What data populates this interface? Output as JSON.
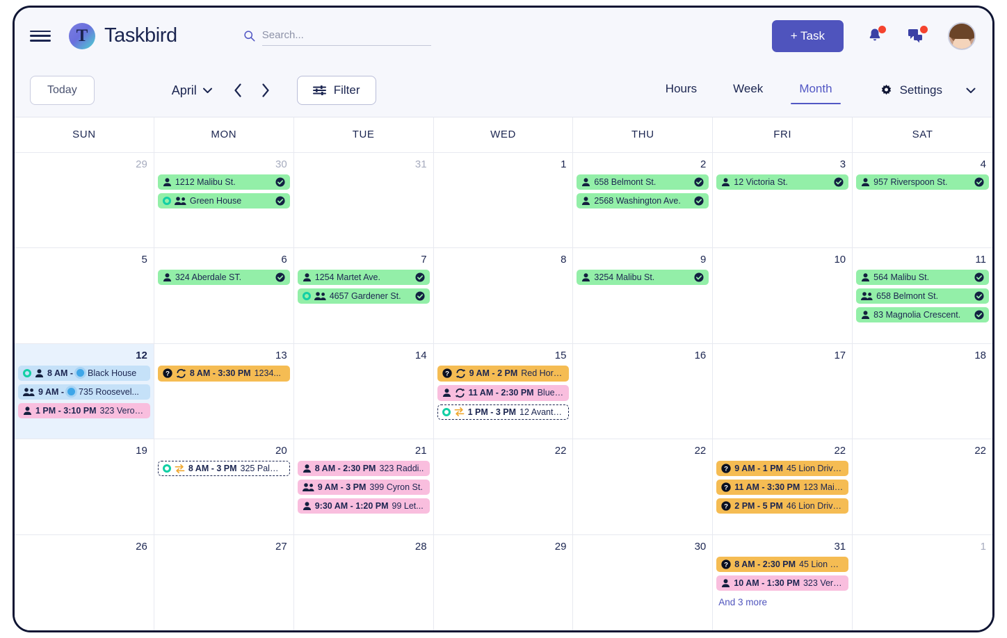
{
  "header": {
    "brand": "Taskbird",
    "menu_icon": "hamburger-icon",
    "search": {
      "placeholder": "Search...",
      "value": "",
      "icon": "search-icon"
    },
    "add_task_label": "+ Task",
    "notifications_icon": "bell-icon",
    "messages_icon": "chat-icon",
    "avatar_label": "user-avatar",
    "accent_color": "#4f54bd",
    "badge_color": "#f5432e"
  },
  "toolbar": {
    "today_label": "Today",
    "month_label": "April",
    "month_caret": "chevron-down-icon",
    "prev_label": "‹",
    "next_label": "›",
    "filter_label": "Filter",
    "filter_icon": "sliders-icon",
    "views": [
      {
        "label": "Hours",
        "active": false
      },
      {
        "label": "Week",
        "active": false
      },
      {
        "label": "Month",
        "active": true
      }
    ],
    "settings_label": "Settings",
    "settings_icon": "gear-icon",
    "settings_caret": "chevron-down-icon"
  },
  "calendar": {
    "weekdays": [
      "SUN",
      "MON",
      "TUE",
      "WED",
      "THU",
      "FRI",
      "SAT"
    ],
    "more_label": "And 3 more",
    "weeks": [
      {
        "days": [
          {
            "num": "29",
            "other": true,
            "today": false,
            "events": []
          },
          {
            "num": "30",
            "other": true,
            "today": false,
            "events": [
              {
                "color": "green",
                "person": "single",
                "text": "1212 Malibu St.",
                "done": true
              },
              {
                "color": "green",
                "ring": true,
                "person": "group",
                "text": "Green House",
                "done": true
              }
            ]
          },
          {
            "num": "31",
            "other": true,
            "today": false,
            "events": []
          },
          {
            "num": "1",
            "other": false,
            "today": false,
            "events": []
          },
          {
            "num": "2",
            "other": false,
            "today": false,
            "events": [
              {
                "color": "green",
                "person": "single",
                "text": "658 Belmont St.",
                "done": true
              },
              {
                "color": "green",
                "person": "single",
                "text": "2568 Washington Ave.",
                "done": true
              }
            ]
          },
          {
            "num": "3",
            "other": false,
            "today": false,
            "events": [
              {
                "color": "green",
                "person": "single",
                "text": "12 Victoria St.",
                "done": true
              }
            ]
          },
          {
            "num": "4",
            "other": false,
            "today": false,
            "events": [
              {
                "color": "green",
                "person": "single",
                "text": "957 Riverspoon St.",
                "done": true
              }
            ]
          }
        ]
      },
      {
        "days": [
          {
            "num": "5",
            "other": false,
            "today": false,
            "events": []
          },
          {
            "num": "6",
            "other": false,
            "today": false,
            "events": [
              {
                "color": "green",
                "person": "single",
                "text": "324 Aberdale ST.",
                "done": true
              }
            ]
          },
          {
            "num": "7",
            "other": false,
            "today": false,
            "events": [
              {
                "color": "green",
                "person": "single",
                "text": "1254 Martet Ave.",
                "done": true
              },
              {
                "color": "green",
                "ring": true,
                "person": "group",
                "text": "4657 Gardener St.",
                "done": true
              }
            ]
          },
          {
            "num": "8",
            "other": false,
            "today": false,
            "events": []
          },
          {
            "num": "9",
            "other": false,
            "today": false,
            "events": [
              {
                "color": "green",
                "person": "single",
                "text": "3254 Malibu St.",
                "done": true
              }
            ]
          },
          {
            "num": "10",
            "other": false,
            "today": false,
            "events": []
          },
          {
            "num": "11",
            "other": false,
            "today": false,
            "events": [
              {
                "color": "green",
                "person": "single",
                "text": "564 Malibu St.",
                "done": true
              },
              {
                "color": "green",
                "person": "group",
                "text": "658 Belmont St.",
                "done": true
              },
              {
                "color": "green",
                "person": "single",
                "text": "83 Magnolia Crescent.",
                "done": true
              }
            ]
          }
        ]
      },
      {
        "days": [
          {
            "num": "12",
            "other": false,
            "today": true,
            "events": [
              {
                "color": "blue",
                "ring": true,
                "person": "single",
                "time": "8 AM -",
                "dot": true,
                "text": "Black House"
              },
              {
                "color": "blue",
                "person": "group",
                "time": "9 AM -",
                "dot": true,
                "text": "735 Roosevel..."
              },
              {
                "color": "pink",
                "person": "single",
                "time": "1 PM - 3:10 PM",
                "text": "323 Veron..."
              }
            ]
          },
          {
            "num": "13",
            "other": false,
            "today": false,
            "events": [
              {
                "color": "orange",
                "help": true,
                "repeat": true,
                "time": "8 AM - 3:30 PM",
                "text": "1234..."
              }
            ]
          },
          {
            "num": "14",
            "other": false,
            "today": false,
            "events": []
          },
          {
            "num": "15",
            "other": false,
            "today": false,
            "events": [
              {
                "color": "orange",
                "help": true,
                "repeat": true,
                "time": "9 AM - 2 PM",
                "text": "Red Horne..."
              },
              {
                "color": "pink",
                "person": "single",
                "repeat": true,
                "time": "11 AM - 2:30 PM",
                "text": "Blue S..."
              },
              {
                "color": "dashed",
                "ring": true,
                "swap": true,
                "time": "1 PM - 3 PM",
                "text": "12 Avant St."
              }
            ]
          },
          {
            "num": "16",
            "other": false,
            "today": false,
            "events": []
          },
          {
            "num": "17",
            "other": false,
            "today": false,
            "events": []
          },
          {
            "num": "18",
            "other": false,
            "today": false,
            "events": []
          }
        ]
      },
      {
        "days": [
          {
            "num": "19",
            "other": false,
            "today": false,
            "events": []
          },
          {
            "num": "20",
            "other": false,
            "today": false,
            "events": [
              {
                "color": "dashed",
                "ring": true,
                "swap": true,
                "time": "8 AM - 3 PM",
                "text": "325 Palm B..."
              }
            ]
          },
          {
            "num": "21",
            "other": false,
            "today": false,
            "events": [
              {
                "color": "pink",
                "person": "single",
                "time": "8 AM - 2:30 PM",
                "text": "323 Raddi.."
              },
              {
                "color": "pink",
                "person": "group",
                "time": "9 AM - 3 PM",
                "text": "399 Cyron St."
              },
              {
                "color": "pink",
                "person": "single",
                "time": "9:30 AM - 1:20 PM",
                "text": "99 Let..."
              }
            ]
          },
          {
            "num": "22",
            "other": false,
            "today": false,
            "events": []
          },
          {
            "num": "22",
            "other": false,
            "today": false,
            "events": []
          },
          {
            "num": "22",
            "other": false,
            "today": false,
            "events": [
              {
                "color": "orange",
                "help": true,
                "time": "9 AM - 1 PM",
                "text": "45 Lion Drive..."
              },
              {
                "color": "orange",
                "help": true,
                "time": "11 AM - 3:30 PM",
                "text": "123 Main..."
              },
              {
                "color": "orange",
                "help": true,
                "time": "2 PM - 5 PM",
                "text": "46 Lion Drive..."
              }
            ]
          },
          {
            "num": "22",
            "other": false,
            "today": false,
            "events": []
          }
        ]
      },
      {
        "days": [
          {
            "num": "26",
            "other": false,
            "today": false,
            "events": []
          },
          {
            "num": "27",
            "other": false,
            "today": false,
            "events": []
          },
          {
            "num": "28",
            "other": false,
            "today": false,
            "events": []
          },
          {
            "num": "29",
            "other": false,
            "today": false,
            "events": []
          },
          {
            "num": "30",
            "other": false,
            "today": false,
            "events": []
          },
          {
            "num": "31",
            "other": false,
            "today": false,
            "more": true,
            "events": [
              {
                "color": "orange",
                "help": true,
                "time": "8 AM - 2:30 PM",
                "text": "45 Lion Dr..."
              },
              {
                "color": "pink",
                "person": "single",
                "time": "10 AM - 1:30 PM",
                "text": "323 Veron..."
              }
            ]
          },
          {
            "num": "1",
            "other": true,
            "today": false,
            "events": []
          }
        ]
      }
    ]
  }
}
